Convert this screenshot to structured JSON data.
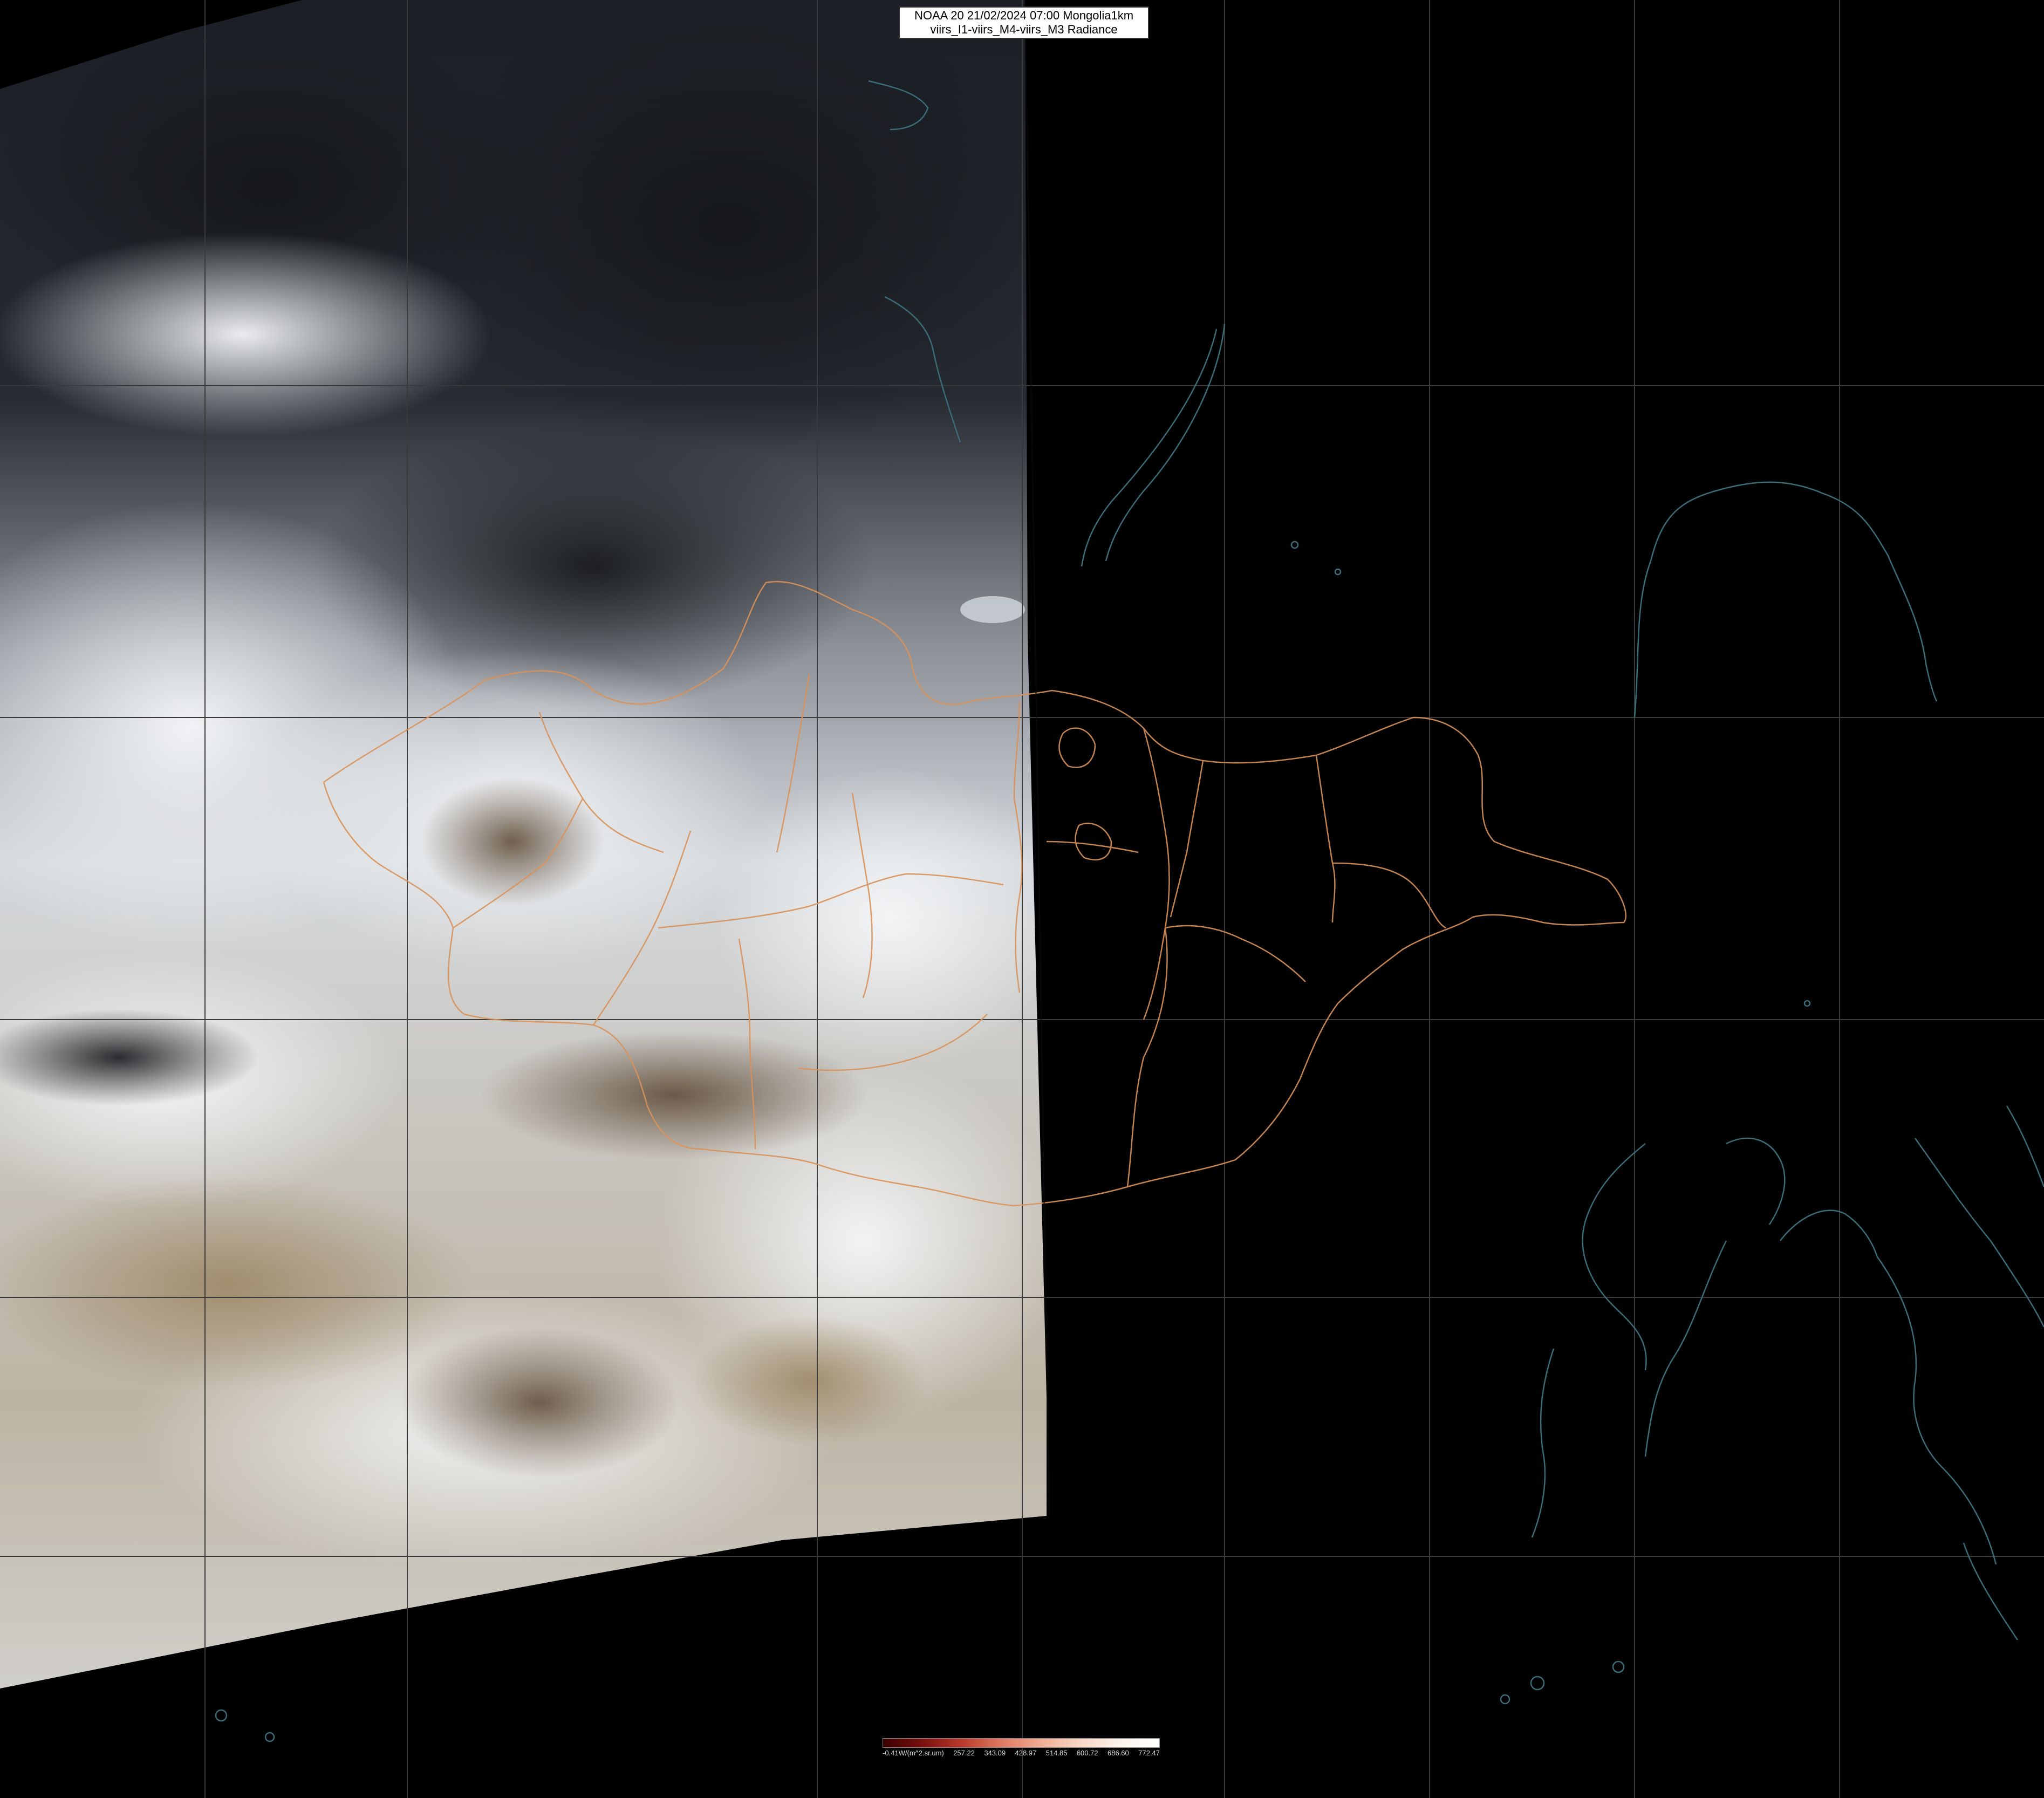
{
  "title": {
    "line1": "NOAA 20 21/02/2024 07:00 Mongolia1km",
    "line2": "viirs_I1-viirs_M4-viirs_M3 Radiance"
  },
  "legend": {
    "ticks": [
      "-0.41W/(m^2.sr.um)",
      "257.22",
      "343.09",
      "428.97",
      "514.85",
      "600.72",
      "686.60",
      "772.47"
    ],
    "colors": [
      "#3a0000",
      "#7a1010",
      "#b83a2a",
      "#e07a62",
      "#f0ac94",
      "#f7d6c6",
      "#fdf3ea",
      "#ffffff"
    ]
  },
  "colors": {
    "background": "#000000",
    "grid": "#3a3a3a",
    "admin_border": "#d9925a",
    "coastline": "#3a6d78",
    "snow": "#e8ecf0",
    "forest": "#1e2126",
    "desert": "#a08a68"
  }
}
